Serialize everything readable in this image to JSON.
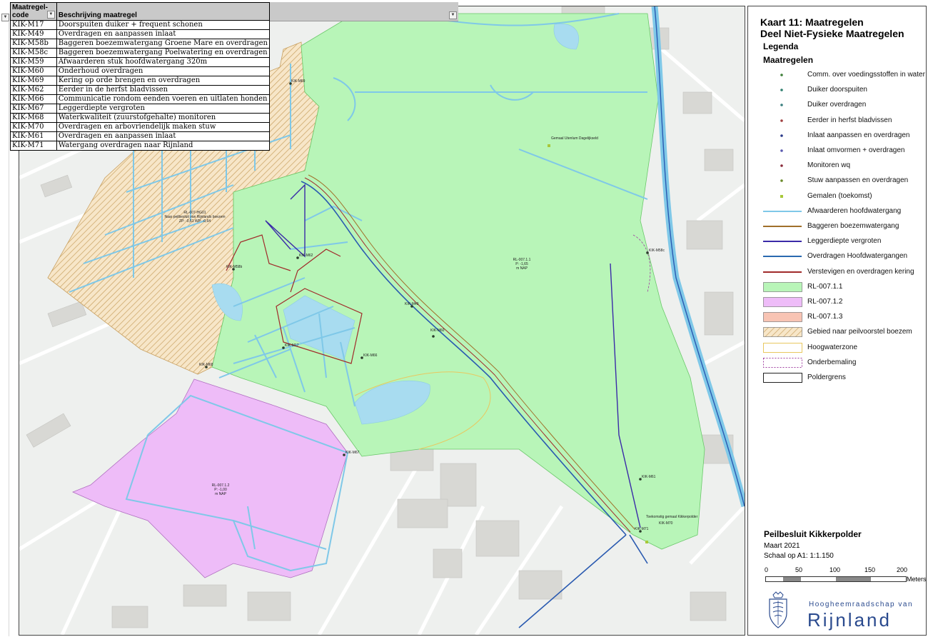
{
  "table": {
    "headers": {
      "code": "Maatregel-\ncode",
      "description": "Beschrijving maatregel"
    },
    "rows": [
      {
        "code": "KIK-M17",
        "description": "Doorspuiten duiker + frequent schonen"
      },
      {
        "code": "KIK-M49",
        "description": "Overdragen en aanpassen inlaat"
      },
      {
        "code": "KIK-M58b",
        "description": "Baggeren boezemwatergang Groene Mare en overdragen"
      },
      {
        "code": "KIK-M58c",
        "description": "Baggeren boezemwatergang Poelwatering en overdragen"
      },
      {
        "code": "KIK-M59",
        "description": "Afwaarderen stuk hoofdwatergang 320m"
      },
      {
        "code": "KIK-M60",
        "description": "Onderhoud overdragen"
      },
      {
        "code": "KIK-M69",
        "description": "Kering op orde brengen en overdragen"
      },
      {
        "code": "KIK-M62",
        "description": "Eerder in de herfst bladvissen"
      },
      {
        "code": "KIK-M66",
        "description": "Communicatie rondom eenden voeren en uitlaten honden"
      },
      {
        "code": "KIK-M67",
        "description": "Leggerdiepte vergroten"
      },
      {
        "code": "KIK-M68",
        "description": "Waterkwaliteit (zuurstofgehalte) monitoren"
      },
      {
        "code": "KIK-M70",
        "description": "Overdragen en arbovriendelijk maken stuw"
      },
      {
        "code": "KIK-M61",
        "description": "Overdragen en aanpassen inlaat"
      },
      {
        "code": "KIK-M71",
        "description": "Watergang overdragen naar Rijnland"
      }
    ]
  },
  "legend": {
    "title_line1": "Kaart 11: Maatregelen",
    "title_line2": "Deel Niet-Fysieke Maatregelen",
    "heading": "Legenda",
    "subheading": "Maatregelen",
    "items": [
      {
        "label": "Comm. over voedingsstoffen in water",
        "kind": "dot",
        "color": "#3f7f3a"
      },
      {
        "label": "Duiker doorspuiten",
        "kind": "dot",
        "color": "#2f7f6f"
      },
      {
        "label": "Duiker overdragen",
        "kind": "dot",
        "color": "#3a7f7f"
      },
      {
        "label": "Eerder in herfst bladvissen",
        "kind": "dot",
        "color": "#a04040"
      },
      {
        "label": "Inlaat aanpassen en overdragen",
        "kind": "dot",
        "color": "#2a3a8a"
      },
      {
        "label": "Inlaat omvormen + overdragen",
        "kind": "dot",
        "color": "#5a5ab0"
      },
      {
        "label": "Monitoren wq",
        "kind": "dot",
        "color": "#8a2a3a"
      },
      {
        "label": "Stuw aanpassen en overdragen",
        "kind": "dot",
        "color": "#6a8a2a"
      },
      {
        "label": "Gemalen (toekomst)",
        "kind": "square",
        "color": "#a8c83a"
      },
      {
        "label": "Afwaarderen hoofdwatergang",
        "kind": "line",
        "color": "#7fc8e8"
      },
      {
        "label": "Baggeren boezemwatergang",
        "kind": "line",
        "color": "#a0702a"
      },
      {
        "label": "Leggerdiepte vergroten",
        "kind": "line",
        "color": "#3a2aa8"
      },
      {
        "label": "Overdragen Hoofdwatergangen",
        "kind": "line",
        "color": "#2a6ab0"
      },
      {
        "label": "Verstevigen en overdragen kering",
        "kind": "line",
        "color": "#a02a2a"
      },
      {
        "label": "RL-007.1.1",
        "kind": "fill",
        "color": "#b8f5b8"
      },
      {
        "label": "RL-007.1.2",
        "kind": "fill",
        "color": "#eebcf8"
      },
      {
        "label": "RL-007.1.3",
        "kind": "fill",
        "color": "#f8c4b4"
      },
      {
        "label": "Gebied naar peilvoorstel boezem",
        "kind": "hatch",
        "color": "#c8a060"
      },
      {
        "label": "Hoogwaterzone",
        "kind": "outline",
        "color": "#e8c860"
      },
      {
        "label": "Onderbemaling",
        "kind": "dashed",
        "color": "#a040a0"
      },
      {
        "label": "Poldergrens",
        "kind": "outline",
        "color": "#222222"
      }
    ]
  },
  "plan": {
    "title": "Peilbesluit Kikkerpolder",
    "date": "Maart 2021",
    "scale": "Schaal op A1: 1:1.150"
  },
  "scalebar": {
    "ticks": [
      "0",
      "50",
      "100",
      "150",
      "200"
    ],
    "unit": "Meters"
  },
  "organisation": {
    "prefix": "Hoogheemraadschap van",
    "name": "Rijnland"
  },
  "map": {
    "zones": [
      {
        "name": "RL-007.1.1",
        "lines": [
          "RL-007.1.1",
          "P: -1,65",
          "m NAP"
        ]
      },
      {
        "name": "RL-007.1.2",
        "lines": [
          "RL-007.1.2",
          "P: -1,00",
          "m NAP"
        ]
      },
      {
        "name": "RL-007.1.3",
        "lines": [
          "RL-007-HG01",
          "Naar peilbesluit van Rijnlands boezem",
          "ZP: -0,61  WP: -0,64"
        ]
      }
    ],
    "feature_labels": [
      "KIK-M69",
      "KIK-M58b",
      "KIK-M62",
      "KIK-M49",
      "KIK-M17",
      "KIK-M66",
      "KIK-M60",
      "KIK-M68",
      "KIK-M67",
      "KIK-M61",
      "KIK-M70",
      "KIK-M71",
      "KIK-M58c"
    ],
    "pump_labels": [
      "Gemaal Utenlum Dagelijkseld",
      "Toekomstig gemaal Kikkerpolder"
    ],
    "colors": {
      "green": "#b8f5b8",
      "pink": "#eebcf8",
      "hatch": "#c8a060",
      "water": "#a8dcf0",
      "boezem": "#2a5ab0",
      "kering": "#a02a2a",
      "background": "#eef0ee"
    }
  }
}
